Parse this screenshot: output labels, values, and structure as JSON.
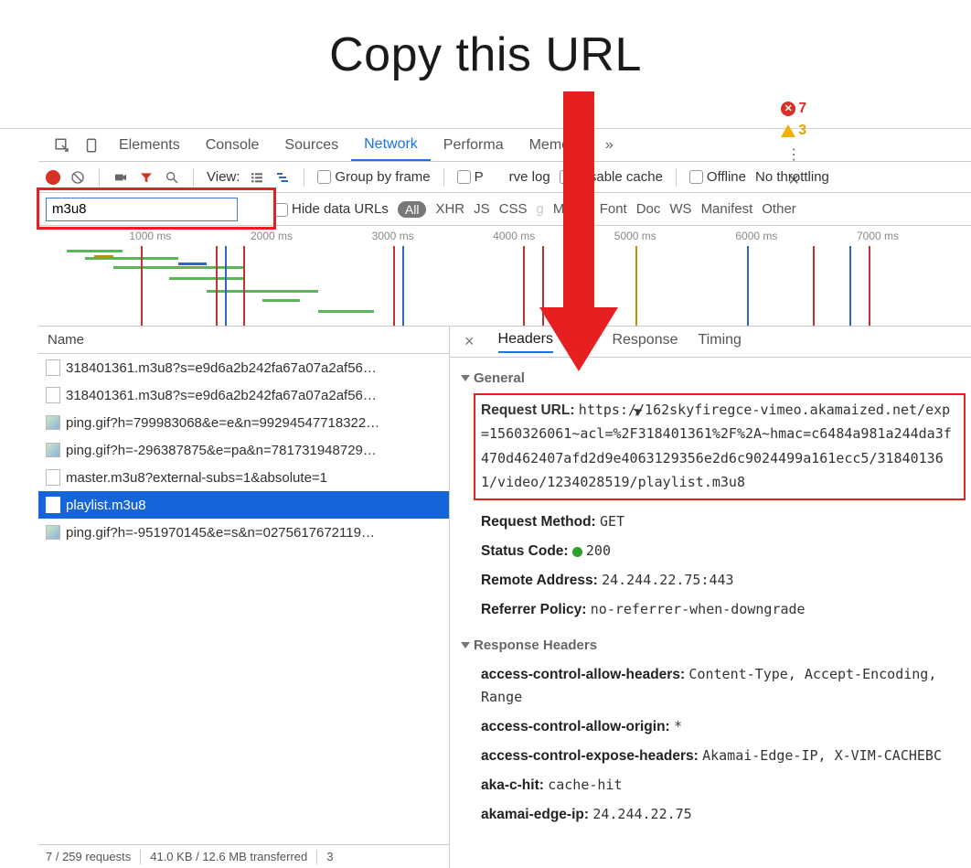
{
  "title": "Copy this URL",
  "tabs": {
    "elements": "Elements",
    "console": "Console",
    "sources": "Sources",
    "network": "Network",
    "performance": "Performa",
    "memory": "Memory"
  },
  "badges": {
    "errors": "7",
    "warnings": "3"
  },
  "toolbar": {
    "view": "View:",
    "group_by_frame": "Group by frame",
    "preserve_log_a": "P",
    "preserve_log_b": "rve log",
    "disable_cache": "Disable cache",
    "offline": "Offline",
    "throttling": "No throttling"
  },
  "filter": {
    "value": "m3u8",
    "hide_data_urls": "Hide data URLs",
    "all": "All",
    "types": [
      "XHR",
      "JS",
      "CSS",
      "g",
      "Media",
      "Font",
      "Doc",
      "WS",
      "Manifest",
      "Other"
    ]
  },
  "timeline_ticks": [
    "1000 ms",
    "2000 ms",
    "3000 ms",
    "4000 ms",
    "5000 ms",
    "6000 ms",
    "7000 ms"
  ],
  "left_header": "Name",
  "requests": [
    {
      "name": "318401361.m3u8?s=e9d6a2b242fa67a07a2af56…",
      "icon": "doc"
    },
    {
      "name": "318401361.m3u8?s=e9d6a2b242fa67a07a2af56…",
      "icon": "doc"
    },
    {
      "name": "ping.gif?h=799983068&e=e&n=99294547718322…",
      "icon": "img"
    },
    {
      "name": "ping.gif?h=-296387875&e=pa&n=781731948729…",
      "icon": "img"
    },
    {
      "name": "master.m3u8?external-subs=1&absolute=1",
      "icon": "doc"
    },
    {
      "name": "playlist.m3u8",
      "icon": "doc",
      "selected": true
    },
    {
      "name": "ping.gif?h=-951970145&e=s&n=0275617672119…",
      "icon": "img"
    }
  ],
  "status": {
    "requests": "7 / 259 requests",
    "transferred": "41.0 KB / 12.6 MB transferred",
    "extra": "3"
  },
  "detail_tabs": {
    "headers": "Headers",
    "preview": "ew",
    "response": "Response",
    "timing": "Timing"
  },
  "general_title": "General",
  "general": {
    "request_url_label": "Request URL:",
    "request_url": "https://162skyfiregce-vimeo.akamaized.net/exp=1560326061~acl=%2F318401361%2F%2A~hmac=c6484a981a244da3f470d462407afd2d9e4063129356e2d6c9024499a161ecc5/318401361/video/1234028519/playlist.m3u8",
    "method_label": "Request Method:",
    "method": "GET",
    "status_label": "Status Code:",
    "status": "200",
    "remote_label": "Remote Address:",
    "remote": "24.244.22.75:443",
    "referrer_label": "Referrer Policy:",
    "referrer": "no-referrer-when-downgrade"
  },
  "resp_title": "Response Headers",
  "resp": {
    "ach_l": "access-control-allow-headers:",
    "ach_v": "Content-Type, Accept-Encoding, Range",
    "aco_l": "access-control-allow-origin:",
    "aco_v": "*",
    "ace_l": "access-control-expose-headers:",
    "ace_v": "Akamai-Edge-IP, X-VIM-CACHEBC",
    "akc_l": "aka-c-hit:",
    "akc_v": "cache-hit",
    "ake_l": "akamai-edge-ip:",
    "ake_v": "24.244.22.75"
  }
}
